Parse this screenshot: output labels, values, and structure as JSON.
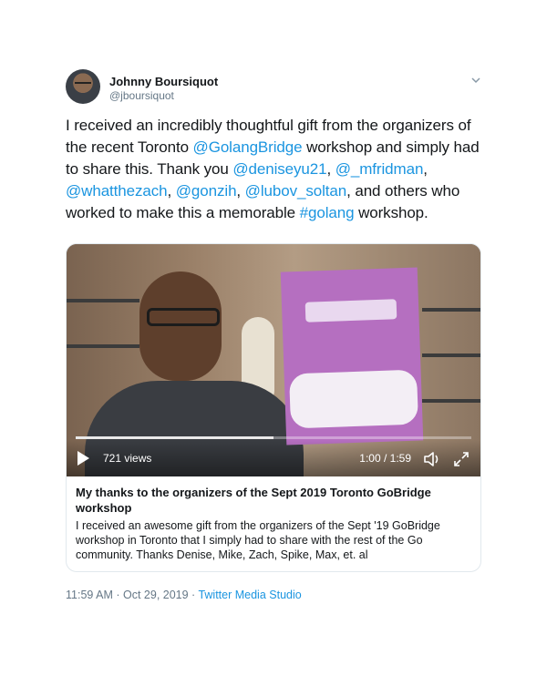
{
  "author": {
    "display_name": "Johnny Boursiquot",
    "handle": "@jboursiquot"
  },
  "tweet": {
    "t1": "I received an incredibly thoughtful gift from the organizers of the recent Toronto ",
    "m_golangbridge": "@GolangBridge",
    "t2": " workshop and simply had to share this. Thank you ",
    "m_deniseyu21": "@deniseyu21",
    "t3": ", ",
    "m_mfridman": "@_mfridman",
    "t4": ", ",
    "m_whatthezach": "@whatthezach",
    "t5": ", ",
    "m_gonzih": "@gonzih",
    "t6": ", ",
    "m_lubov_soltan": "@lubov_soltan",
    "t7": ", and others who worked to make this a memorable ",
    "hashtag_golang": "#golang",
    "t8": " workshop."
  },
  "video": {
    "views": "721 views",
    "time": "1:00 / 1:59",
    "progress": 0.5
  },
  "card": {
    "title": "My thanks to the organizers of the Sept 2019 Toronto GoBridge workshop",
    "description": "I received an awesome gift from the organizers of the Sept '19 GoBridge workshop in Toronto that I simply had to share with the rest of the Go community. Thanks Denise, Mike, Zach, Spike, Max, et. al"
  },
  "meta": {
    "timestamp": "11:59 AM · Oct 29, 2019 · ",
    "source": "Twitter Media Studio"
  },
  "colors": {
    "link": "#1b95e0",
    "secondary_text": "#657786",
    "border": "#e1e8ed"
  },
  "icons": [
    "chevron-down-icon",
    "play-icon",
    "volume-icon",
    "fullscreen-icon"
  ]
}
